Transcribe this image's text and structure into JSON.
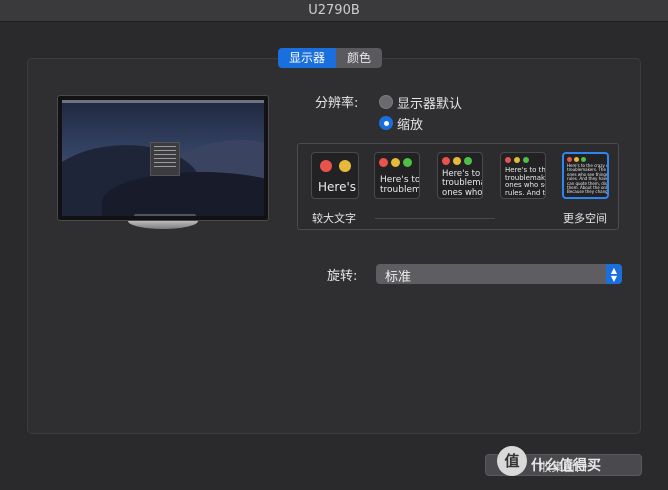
{
  "window": {
    "title": "U2790B"
  },
  "tabs": [
    {
      "label": "显示器",
      "active": true
    },
    {
      "label": "颜色",
      "active": false
    }
  ],
  "resolution": {
    "label": "分辨率:",
    "options": [
      {
        "label": "显示器默认",
        "selected": false
      },
      {
        "label": "缩放",
        "selected": true
      }
    ]
  },
  "scaling": {
    "left_label": "较大文字",
    "right_label": "更多空间",
    "thumbs": [
      {
        "text": "Here's"
      },
      {
        "text": "Here's to\ntroublem"
      },
      {
        "text": "Here's to t\ntroublema\nones who"
      },
      {
        "text": "Here's to the cr\ntroublemakers.\nones who see th\nrules. And they"
      },
      {
        "text": "Here's to the crazy ones\ntroublemakers. The rou\nones who see things diff\nrules. And they have no\ncan quote them, disagre\nthem. About the only thi\nBecause they change th"
      }
    ],
    "selected_index": 4
  },
  "rotation": {
    "label": "旋转:",
    "value": "标准"
  },
  "gather_windows_button": "收集窗口",
  "watermark": {
    "icon": "值",
    "text": "什么值得买"
  },
  "colors": {
    "accent": "#1a6fdc",
    "window_bg": "#2a2a2c",
    "close": "#e8534b",
    "minimize": "#e6b93a",
    "zoom": "#4fbf47"
  }
}
